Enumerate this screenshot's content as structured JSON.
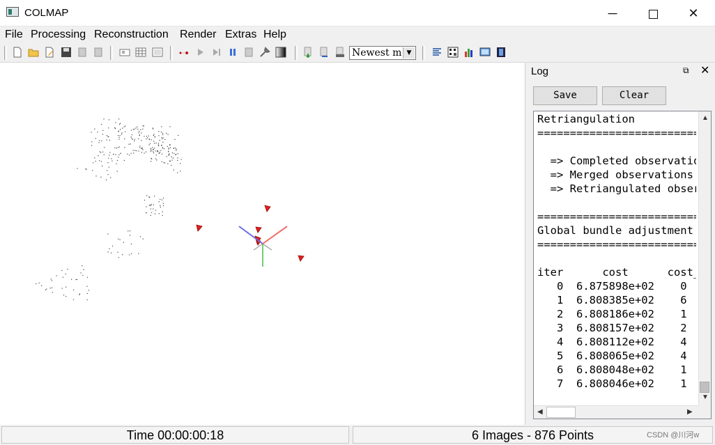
{
  "window": {
    "title": "COLMAP",
    "minimize": "─",
    "close": "✕"
  },
  "menu": [
    "File",
    "Processing",
    "Reconstruction",
    "Render",
    "Extras",
    "Help"
  ],
  "toolbar": {
    "icons": [
      "new-project-icon",
      "open-project-icon",
      "edit-project-icon",
      "save-project-icon",
      "import-model-icon",
      "export-model-icon",
      "feature-extraction-icon",
      "feature-matching-icon",
      "database-management-icon",
      "reconstruction-start-icon",
      "reconstruction-step-icon",
      "reconstruction-pause-icon",
      "reconstruction-reset-icon",
      "bundle-adjustment-icon",
      "dense-reconstruction-icon",
      "render-options-icon",
      "import-icon",
      "export-icon",
      "save-icon"
    ],
    "reconstruction_select": "Newest m",
    "right_icons": [
      "log-icon",
      "match-matrix-icon",
      "statistics-icon",
      "grab-image-icon",
      "grab-movie-icon"
    ]
  },
  "log": {
    "title": "Log",
    "float_icon": "⧉",
    "close_icon": "✕",
    "save_label": "Save",
    "clear_label": "Clear",
    "lines": [
      "Retriangulation",
      "==========================",
      "",
      "  => Completed observations",
      "  => Merged observations",
      "  => Retriangulated observations",
      "",
      "==========================",
      "Global bundle adjustment",
      "==========================",
      "",
      "iter      cost      cost_change",
      "   0  6.875898e+02    0",
      "   1  6.808385e+02    6",
      "   2  6.808186e+02    1",
      "   3  6.808157e+02    2",
      "   4  6.808112e+02    4",
      "   5  6.808065e+02    4",
      "   6  6.808048e+02    1",
      "   7  6.808046e+02    1"
    ]
  },
  "status": {
    "time": "Time 00:00:00:18",
    "summary": "6 Images - 876 Points"
  },
  "watermark": "CSDN @川河w",
  "colors": {
    "camera": "#e02020",
    "axis_x": "#f07070",
    "axis_y": "#70d070",
    "axis_z": "#6a6ae0"
  }
}
